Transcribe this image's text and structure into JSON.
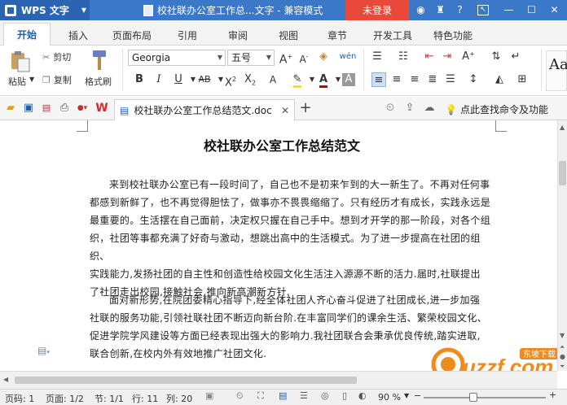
{
  "app": {
    "name": "WPS 文字",
    "window_title": "校社联办公室工作总...文字 - 兼容模式",
    "login_label": "未登录"
  },
  "tabs": [
    "开始",
    "插入",
    "页面布局",
    "引用",
    "审阅",
    "视图",
    "章节",
    "开发工具",
    "特色功能"
  ],
  "ribbon": {
    "paste_label": "粘贴",
    "cut_label": "剪切",
    "copy_label": "复制",
    "format_painter_label": "格式刷",
    "font_name": "Georgia",
    "font_size": "五号",
    "style_preview": "Aa"
  },
  "doc_tab": {
    "title": "校社联办公室工作总结范文.doc"
  },
  "search_hint": "点此查找命令及功能",
  "document": {
    "title": "校社联办公室工作总结范文",
    "paragraphs": [
      [
        "来到校社联办公室已有一段时间了，自己也不是初来乍到的大一新生了。不再对任何事",
        "都感到新鲜了，也不再觉得胆怯了，做事亦不畏畏缩缩了。只有经历才有成长，实践永远是",
        "最重要的。生活摆在自己面前，决定权只握在自己手中。想到才开学的那一阶段，对各个组",
        "织，社团等事都充满了好奇与激动，想跳出高中的生活模式。为了进一步提高在社团的组织、",
        "实践能力,发扬社团的自主性和创造性给校园文化生活注入源源不断的活力.届时,社联提出",
        "了社团走出校园,接触社会,推向新高潮新方针."
      ],
      [
        "面对新形势,在院团委精心指导下,经全体社团人齐心奋斗促进了社团成长,进一步加强",
        "社联的服务功能,引领社联社团不断迈向新台阶.在丰富同学们的课余生活、繁荣校园文化、",
        "促进学院学风建设等方面已经表现出强大的影响力.我社团联合会秉承优良传统,踏实进取,",
        "联合创新,在校内外有效地推广社团文化."
      ]
    ]
  },
  "status": {
    "page_num": "页码: 1",
    "page": "页面: 1/2",
    "section": "节: 1/1",
    "row": "行: 11",
    "col": "列: 20",
    "zoom": "90 %"
  },
  "watermark": {
    "text": "uzzf.com",
    "sub": "东坡下载"
  },
  "colors": {
    "titlebar": "#3c78c8",
    "login": "#e8493a",
    "accent": "#1d5fb0"
  }
}
